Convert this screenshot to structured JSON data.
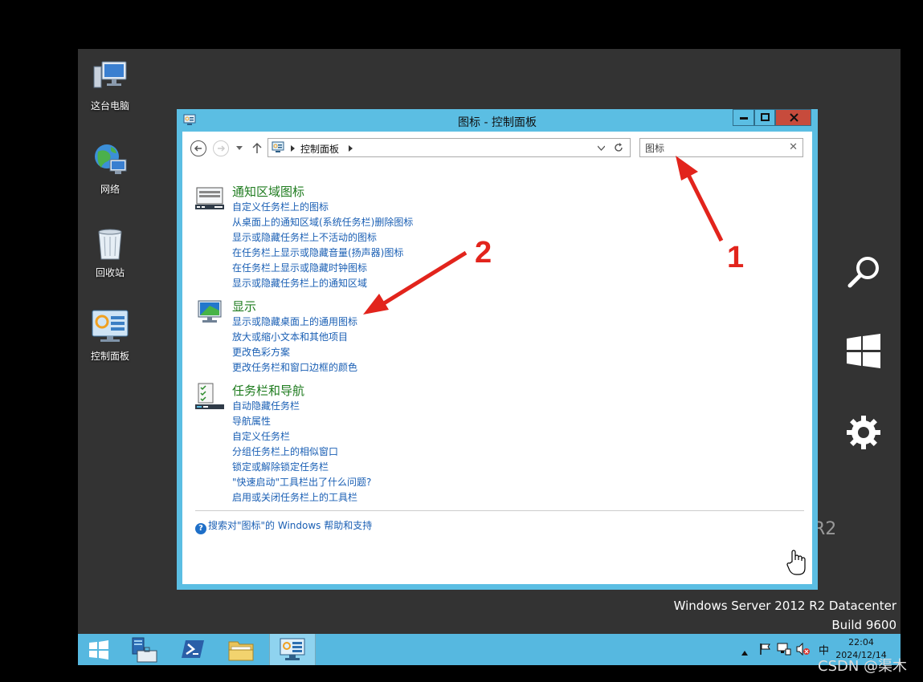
{
  "desktop": {
    "icons": [
      {
        "label": "这台电脑"
      },
      {
        "label": "网络"
      },
      {
        "label": "回收站"
      },
      {
        "label": "控制面板"
      }
    ]
  },
  "window": {
    "title": "图标 - 控制面板",
    "address": {
      "crumb": "控制面板"
    },
    "search": {
      "value": "图标"
    },
    "sections": [
      {
        "heading": "通知区域图标",
        "icon": "notification-area-icon",
        "links": [
          "自定义任务栏上的图标",
          "从桌面上的通知区域(系统任务栏)删除图标",
          "显示或隐藏任务栏上不活动的图标",
          "在任务栏上显示或隐藏音量(扬声器)图标",
          "在任务栏上显示或隐藏时钟图标",
          "显示或隐藏任务栏上的通知区域"
        ]
      },
      {
        "heading": "显示",
        "icon": "display-icon",
        "links": [
          "显示或隐藏桌面上的通用图标",
          "放大或缩小文本和其他项目",
          "更改色彩方案",
          "更改任务栏和窗口边框的颜色"
        ]
      },
      {
        "heading": "任务栏和导航",
        "icon": "taskbar-navigation-icon",
        "links": [
          "自动隐藏任务栏",
          "导航属性",
          "自定义任务栏",
          "分组任务栏上的相似窗口",
          "锁定或解除锁定任务栏",
          "\"快速启动\"工具栏出了什么问题?",
          "启用或关闭任务栏上的工具栏"
        ]
      }
    ],
    "help_link": "搜索对\"图标\"的 Windows 帮助和支持"
  },
  "os_info": {
    "edition": "Windows Server 2012 R2 Datacenter",
    "build": "Build 9600",
    "r2_mark": "R2"
  },
  "taskbar": {
    "ime": "中",
    "time": "22:04",
    "date": "2024/12/14"
  },
  "annotations": {
    "label1": "1",
    "label2": "2"
  },
  "watermark": "CSDN @渠木",
  "colors": {
    "taskbar": "#56b8e0",
    "window_frame": "#5bbee3",
    "link": "#1a5fb4",
    "heading": "#1e7b1e",
    "arrow": "#e2241c"
  }
}
